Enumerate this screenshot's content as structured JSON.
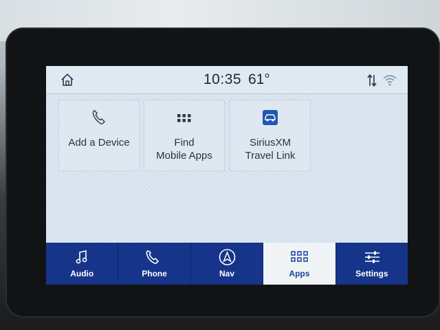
{
  "status": {
    "time": "10:35",
    "temperature": "61°",
    "icons": [
      "home-icon",
      "data-sync-icon",
      "wifi-icon"
    ]
  },
  "apps": [
    {
      "label_line1": "Add a Device",
      "label_line2": "",
      "icon": "phone-icon"
    },
    {
      "label_line1": "Find",
      "label_line2": "Mobile Apps",
      "icon": "grid-icon"
    },
    {
      "label_line1": "SiriusXM",
      "label_line2": "Travel Link",
      "icon": "car-icon"
    }
  ],
  "nav": {
    "active": "Apps",
    "items": [
      {
        "label": "Audio",
        "icon": "music-note-icon"
      },
      {
        "label": "Phone",
        "icon": "phone-icon"
      },
      {
        "label": "Nav",
        "icon": "navigation-icon"
      },
      {
        "label": "Apps",
        "icon": "apps-grid-icon"
      },
      {
        "label": "Settings",
        "icon": "sliders-icon"
      }
    ]
  },
  "colors": {
    "nav_bar": "#16358a",
    "nav_active_bg": "#f1f4f7",
    "screen_bg": "#d5e2ee",
    "sirius_icon": "#1f57b3"
  }
}
